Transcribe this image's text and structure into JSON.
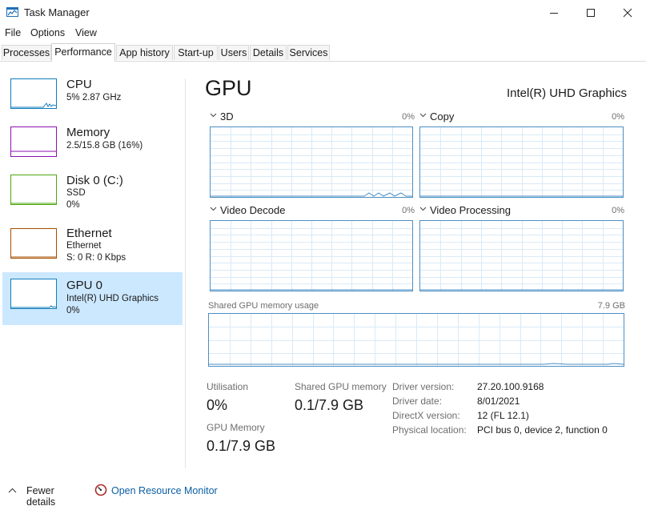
{
  "window": {
    "title": "Task Manager"
  },
  "menu": [
    "File",
    "Options",
    "View"
  ],
  "tabs": [
    "Processes",
    "Performance",
    "App history",
    "Start-up",
    "Users",
    "Details",
    "Services"
  ],
  "sidebar": [
    {
      "title": "CPU",
      "line1": "5% 2.87 GHz",
      "line2": "",
      "border": "#117dbb",
      "line": "#117dbb"
    },
    {
      "title": "Memory",
      "line1": "2.5/15.8 GB (16%)",
      "line2": "",
      "border": "#8b12ae",
      "line": "#8b12ae"
    },
    {
      "title": "Disk 0 (C:)",
      "line1": "SSD",
      "line2": "0%",
      "border": "#4da60c",
      "line": "#4da60c"
    },
    {
      "title": "Ethernet",
      "line1": "Ethernet",
      "line2": "S: 0 R: 0 Kbps",
      "border": "#a74f01",
      "line": "#a74f01"
    },
    {
      "title": "GPU 0",
      "line1": "Intel(R) UHD Graphics",
      "line2": "0%",
      "border": "#117dbb",
      "line": "#117dbb"
    }
  ],
  "gpu": {
    "title": "GPU",
    "name": "Intel(R) UHD Graphics",
    "graphs": [
      {
        "label": "3D",
        "percent": "0%"
      },
      {
        "label": "Copy",
        "percent": "0%"
      },
      {
        "label": "Video Decode",
        "percent": "0%"
      },
      {
        "label": "Video Processing",
        "percent": "0%"
      }
    ],
    "shared_caption": "Shared GPU memory usage",
    "shared_max": "7.9 GB",
    "stats": {
      "utilisation_label": "Utilisation",
      "utilisation_value": "0%",
      "shared_label": "Shared GPU memory",
      "shared_value": "0.1/7.9 GB",
      "gpu_memory_label": "GPU Memory",
      "gpu_memory_value": "0.1/7.9 GB"
    },
    "info": [
      {
        "k": "Driver version:",
        "v": "27.20.100.9168"
      },
      {
        "k": "Driver date:",
        "v": "8/01/2021"
      },
      {
        "k": "DirectX version:",
        "v": "12 (FL 12.1)"
      },
      {
        "k": "Physical location:",
        "v": "PCI bus 0, device 2, function 0"
      }
    ]
  },
  "footer": {
    "fewer": "Fewer details",
    "monitor": "Open Resource Monitor"
  },
  "colors": {
    "accent": "#117dbb",
    "graph_border": "#4b8fc4",
    "grid": "#d9eaf7",
    "selected": "#cce8ff"
  }
}
